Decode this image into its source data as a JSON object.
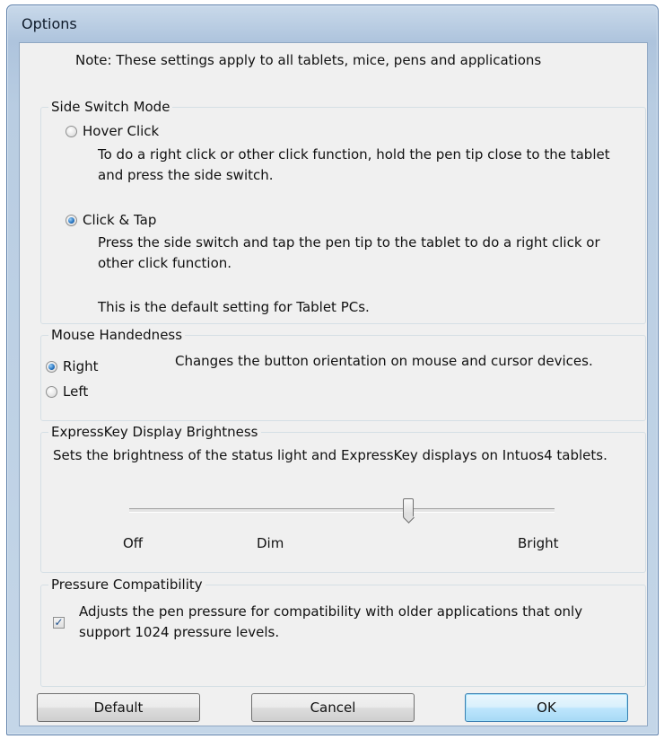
{
  "window": {
    "title": "Options"
  },
  "note": "Note: These settings apply to all tablets, mice, pens and applications",
  "side_switch": {
    "legend": "Side Switch Mode",
    "options": [
      {
        "label": "Hover Click",
        "description": "To do a right click or other click function, hold the pen tip close to the tablet and press the side switch.",
        "selected": false
      },
      {
        "label": "Click & Tap",
        "description": "Press the side switch and tap the pen tip to the tablet to do a right click or other click function.",
        "selected": true
      }
    ],
    "default_note": "This is the default setting for Tablet PCs."
  },
  "mouse_handedness": {
    "legend": "Mouse Handedness",
    "description": "Changes the button orientation on mouse and cursor devices.",
    "options": [
      {
        "label": "Right",
        "selected": true
      },
      {
        "label": "Left",
        "selected": false
      }
    ]
  },
  "expresskey": {
    "legend": "ExpressKey Display Brightness",
    "description": "Sets the brightness of the status light and ExpressKey displays on Intuos4 tablets.",
    "labels": {
      "off": "Off",
      "dim": "Dim",
      "bright": "Bright"
    },
    "slider_value": 0.67
  },
  "pressure": {
    "legend": "Pressure Compatibility",
    "checkbox_label": "Adjusts the pen pressure for compatibility with older applications that only support 1024 pressure levels.",
    "checked": true
  },
  "buttons": {
    "default": "Default",
    "cancel": "Cancel",
    "ok": "OK"
  },
  "colors": {
    "accent": "#2a78c5",
    "ok_border": "#3c7fb1",
    "frame": "#aec4dd"
  }
}
